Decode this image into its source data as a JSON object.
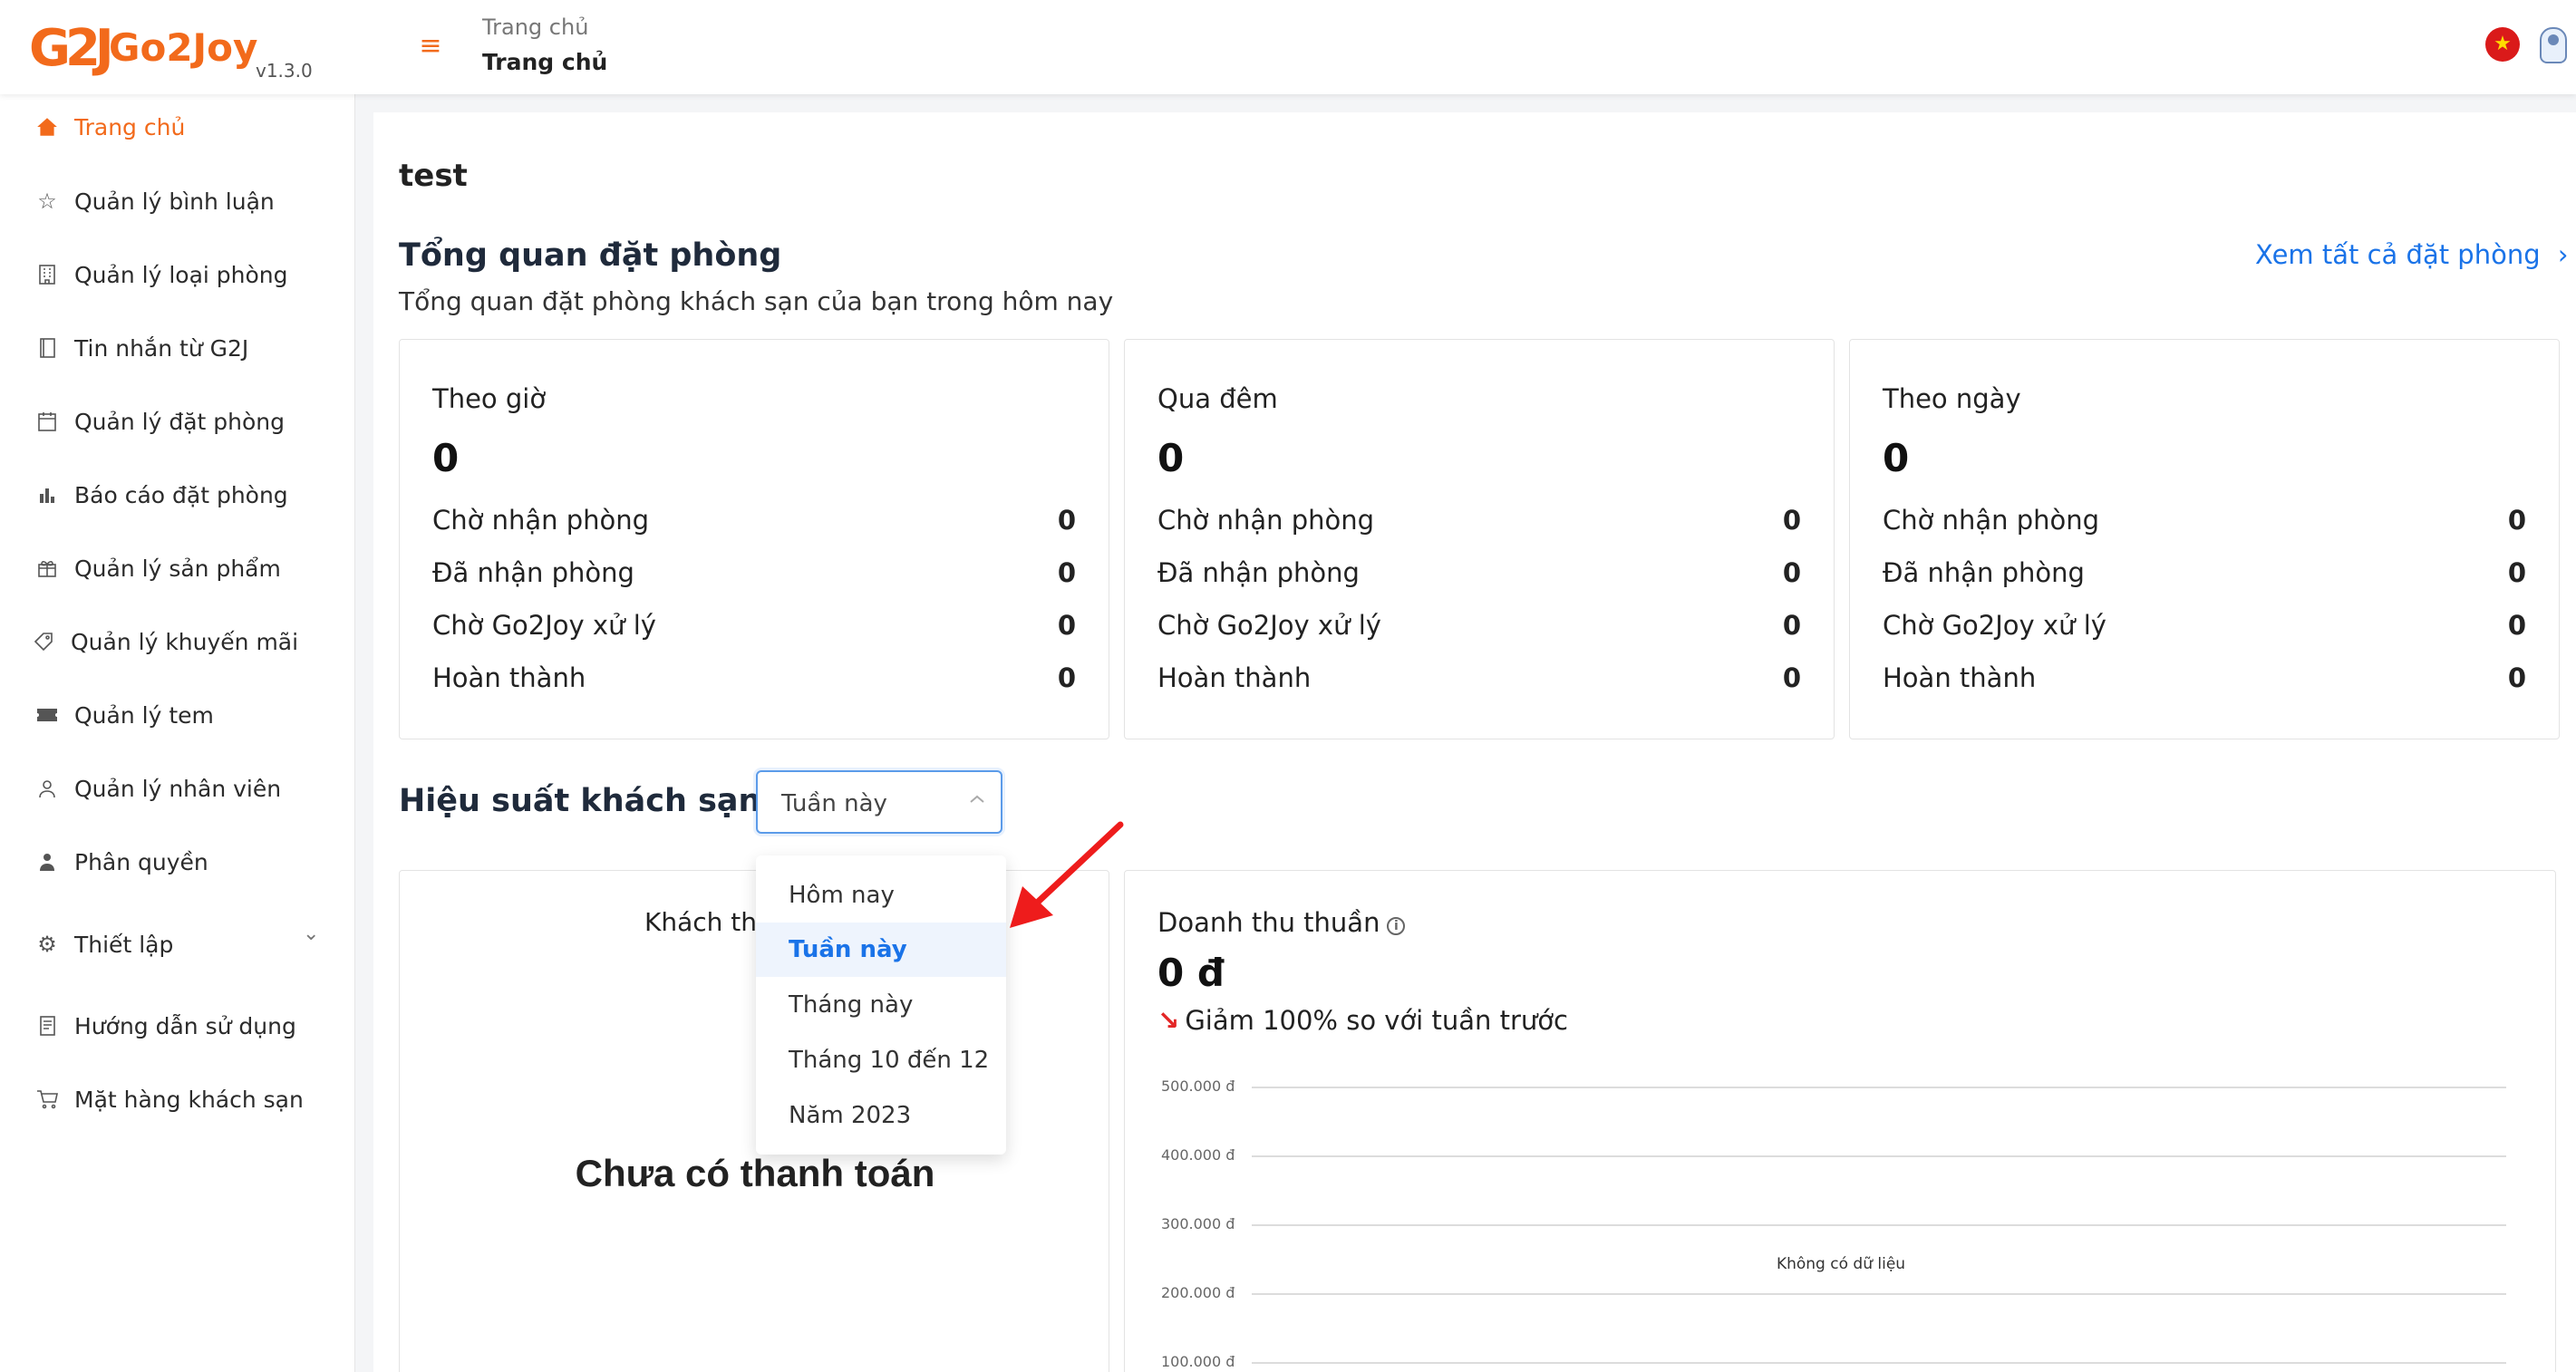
{
  "app": {
    "logo_mark": "G2J",
    "name": "Go2Joy",
    "version": "v1.3.0"
  },
  "header": {
    "breadcrumb": "Trang chủ",
    "title": "Trang chủ"
  },
  "sidebar": {
    "items": [
      {
        "label": "Trang chủ",
        "icon": "home-icon",
        "active": true
      },
      {
        "label": "Quản lý bình luận",
        "icon": "star-icon"
      },
      {
        "label": "Quản lý loại phòng",
        "icon": "building-icon"
      },
      {
        "label": "Tin nhắn từ G2J",
        "icon": "notebook-icon"
      },
      {
        "label": "Quản lý đặt phòng",
        "icon": "calendar-icon"
      },
      {
        "label": "Báo cáo đặt phòng",
        "icon": "bar-chart-icon"
      },
      {
        "label": "Quản lý sản phẩm",
        "icon": "gift-icon"
      },
      {
        "label": "Quản lý khuyến mãi",
        "icon": "tag-icon"
      },
      {
        "label": "Quản lý tem",
        "icon": "ticket-icon"
      },
      {
        "label": "Quản lý nhân viên",
        "icon": "user-icon"
      },
      {
        "label": "Phân quyền",
        "icon": "user-shield-icon"
      },
      {
        "label": "Thiết lập",
        "icon": "gear-icon"
      },
      {
        "label": "Hướng dẫn sử dụng",
        "icon": "book-icon"
      },
      {
        "label": "Mặt hàng khách sạn",
        "icon": "cart-icon"
      }
    ]
  },
  "main": {
    "page_name": "test",
    "overview": {
      "title": "Tổng quan đặt phòng",
      "subtitle": "Tổng quan đặt phòng khách sạn của bạn trong hôm nay",
      "view_all": "Xem tất cả đặt phòng"
    },
    "cards": [
      {
        "title": "Theo giờ",
        "total": "0",
        "rows": [
          {
            "label": "Chờ nhận phòng",
            "value": "0"
          },
          {
            "label": "Đã nhận phòng",
            "value": "0"
          },
          {
            "label": "Chờ Go2Joy xử lý",
            "value": "0"
          },
          {
            "label": "Hoàn thành",
            "value": "0"
          }
        ]
      },
      {
        "title": "Qua đêm",
        "total": "0",
        "rows": [
          {
            "label": "Chờ nhận phòng",
            "value": "0"
          },
          {
            "label": "Đã nhận phòng",
            "value": "0"
          },
          {
            "label": "Chờ Go2Joy xử lý",
            "value": "0"
          },
          {
            "label": "Hoàn thành",
            "value": "0"
          }
        ]
      },
      {
        "title": "Theo ngày",
        "total": "0",
        "rows": [
          {
            "label": "Chờ nhận phòng",
            "value": "0"
          },
          {
            "label": "Đã nhận phòng",
            "value": "0"
          },
          {
            "label": "Chờ Go2Joy xử lý",
            "value": "0"
          },
          {
            "label": "Hoàn thành",
            "value": "0"
          }
        ]
      }
    ],
    "performance": {
      "title": "Hiệu suất khách sạn",
      "period_select": "Tuần này",
      "period_options": [
        "Hôm nay",
        "Tuần này",
        "Tháng này",
        "Tháng 10 đến 12",
        "Năm 2023"
      ],
      "selected_index": 1
    },
    "left_panel": {
      "title": "Khách tha",
      "empty": "Chưa có thanh toán"
    },
    "revenue": {
      "title": "Doanh thu thuần",
      "value": "0 đ",
      "trend": "Giảm 100% so với tuần trước",
      "trend_color": "#e32626",
      "no_data": "Không có dữ liệu"
    }
  },
  "chart_data": {
    "type": "line",
    "title": "",
    "y_ticks": [
      "500.000 đ",
      "400.000 đ",
      "300.000 đ",
      "200.000 đ",
      "100.000 đ"
    ],
    "series": []
  },
  "colors": {
    "brand": "#f26a1b",
    "link": "#1a73e8"
  }
}
